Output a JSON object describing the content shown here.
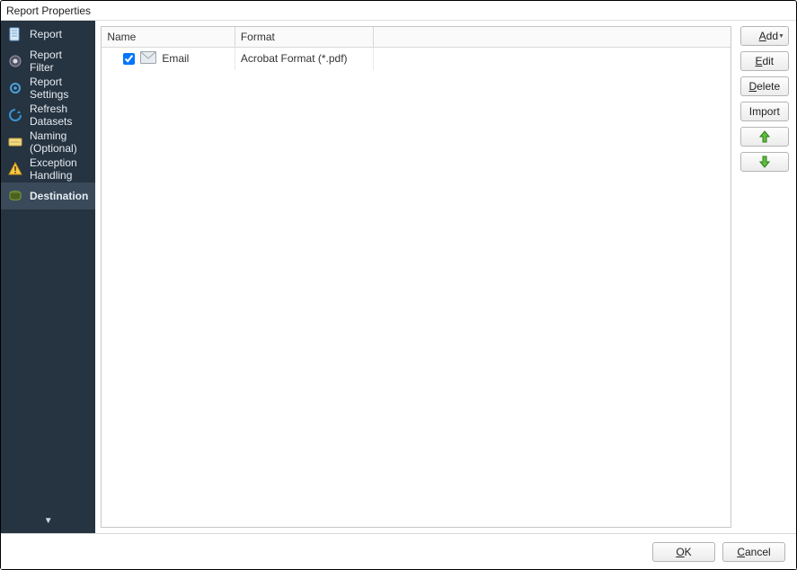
{
  "window": {
    "title": "Report Properties"
  },
  "sidebar": {
    "items": [
      {
        "label": "Report"
      },
      {
        "label": "Report Filter"
      },
      {
        "label": "Report Settings"
      },
      {
        "label": "Refresh Datasets"
      },
      {
        "label": "Naming (Optional)"
      },
      {
        "label": "Exception Handling"
      },
      {
        "label": "Destination",
        "selected": true
      }
    ]
  },
  "table": {
    "columns": {
      "col0": "Name",
      "col1": "Format",
      "col2": ""
    },
    "rows": [
      {
        "checked": true,
        "name": "Email",
        "format": "Acrobat Format (*.pdf)"
      }
    ]
  },
  "actions": {
    "add": "Add",
    "edit": "Edit",
    "delete": "Delete",
    "import": "Import"
  },
  "footer": {
    "ok": "OK",
    "cancel": "Cancel"
  }
}
